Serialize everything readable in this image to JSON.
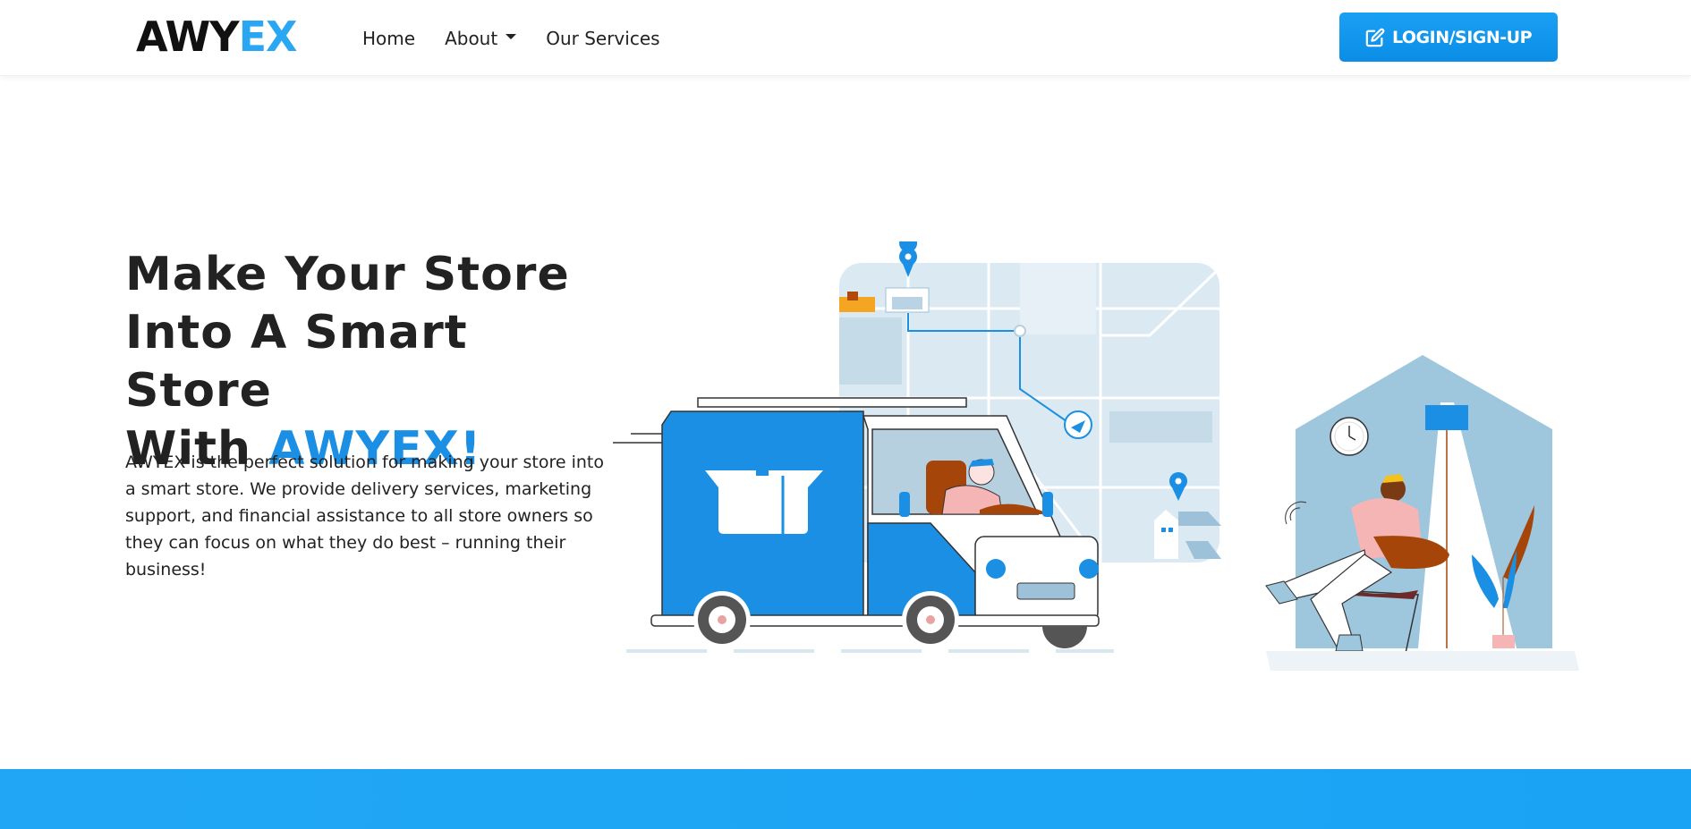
{
  "brand": {
    "logo_part1": "AWY",
    "logo_part2": "EX",
    "accent_color": "#1a8fe3"
  },
  "nav": {
    "items": [
      {
        "label": "Home",
        "has_dropdown": false
      },
      {
        "label": "About",
        "has_dropdown": true
      },
      {
        "label": "Our Services",
        "has_dropdown": false
      }
    ],
    "login_label": "LOGIN/SIGN-UP",
    "login_icon": "edit-icon"
  },
  "hero": {
    "title_line1": "Make Your Store",
    "title_line2": "Into A Smart Store",
    "title_line3_prefix": "With ",
    "title_accent": "AWYEX!",
    "description": "AWYEX is the perfect solution for making your store into a smart store. We provide delivery services, marketing support, and financial assistance to all store owners so they can focus on what they do best – running their business!"
  },
  "illustration": {
    "subject": "delivery-truck-map-illustration"
  }
}
